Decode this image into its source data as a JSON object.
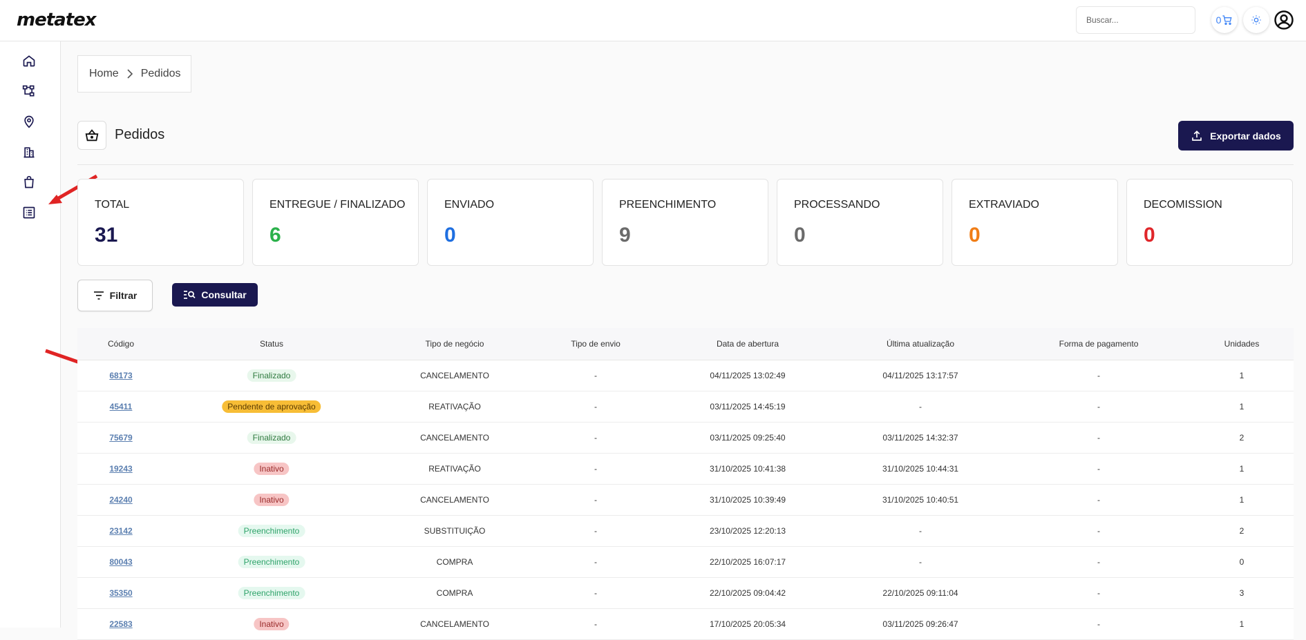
{
  "app": {
    "logo": "metatex"
  },
  "header": {
    "search_placeholder": "Buscar...",
    "cart_count": "0",
    "icons": [
      "cart-icon",
      "sun-icon",
      "user-circle-icon"
    ]
  },
  "sidebar": {
    "icons": [
      "home-icon",
      "hierarchy-icon",
      "location-pin-icon",
      "buildings-icon",
      "shopping-bag-icon",
      "list-icon"
    ]
  },
  "breadcrumb": {
    "home": "Home",
    "current": "Pedidos"
  },
  "page": {
    "title": "Pedidos",
    "export_label": "Exportar dados"
  },
  "stats": [
    {
      "label": "TOTAL",
      "value": "31",
      "color": "#1a1850"
    },
    {
      "label": "ENTREGUE / FINALIZADO",
      "value": "6",
      "color": "#2bb14b"
    },
    {
      "label": "ENVIADO",
      "value": "0",
      "color": "#1f6fe0"
    },
    {
      "label": "PREENCHIMENTO",
      "value": "9",
      "color": "#6b6b6b"
    },
    {
      "label": "PROCESSANDO",
      "value": "0",
      "color": "#6b6b6b"
    },
    {
      "label": "EXTRAVIADO",
      "value": "0",
      "color": "#f07d16"
    },
    {
      "label": "DECOMISSION",
      "value": "0",
      "color": "#e0262a"
    }
  ],
  "actions": {
    "filter_label": "Filtrar",
    "consult_label": "Consultar"
  },
  "table": {
    "columns": [
      "Código",
      "Status",
      "Tipo de negócio",
      "Tipo de envio",
      "Data de abertura",
      "Última atualização",
      "Forma de pagamento",
      "Unidades"
    ],
    "rows": [
      {
        "code": "68173",
        "status": "Finalizado",
        "status_type": "final",
        "business": "CANCELAMENTO",
        "shipping": "-",
        "opened": "04/11/2025 13:02:49",
        "updated": "04/11/2025 13:17:57",
        "payment": "-",
        "units": "1"
      },
      {
        "code": "45411",
        "status": "Pendente de aprovação",
        "status_type": "pend",
        "business": "REATIVAÇÃO",
        "shipping": "-",
        "opened": "03/11/2025 14:45:19",
        "updated": "-",
        "payment": "-",
        "units": "1"
      },
      {
        "code": "75679",
        "status": "Finalizado",
        "status_type": "final",
        "business": "CANCELAMENTO",
        "shipping": "-",
        "opened": "03/11/2025 09:25:40",
        "updated": "03/11/2025 14:32:37",
        "payment": "-",
        "units": "2"
      },
      {
        "code": "19243",
        "status": "Inativo",
        "status_type": "inat",
        "business": "REATIVAÇÃO",
        "shipping": "-",
        "opened": "31/10/2025 10:41:38",
        "updated": "31/10/2025 10:44:31",
        "payment": "-",
        "units": "1"
      },
      {
        "code": "24240",
        "status": "Inativo",
        "status_type": "inat",
        "business": "CANCELAMENTO",
        "shipping": "-",
        "opened": "31/10/2025 10:39:49",
        "updated": "31/10/2025 10:40:51",
        "payment": "-",
        "units": "1"
      },
      {
        "code": "23142",
        "status": "Preenchimento",
        "status_type": "pree",
        "business": "SUBSTITUIÇÃO",
        "shipping": "-",
        "opened": "23/10/2025 12:20:13",
        "updated": "-",
        "payment": "-",
        "units": "2"
      },
      {
        "code": "80043",
        "status": "Preenchimento",
        "status_type": "pree",
        "business": "COMPRA",
        "shipping": "-",
        "opened": "22/10/2025 16:07:17",
        "updated": "-",
        "payment": "-",
        "units": "0"
      },
      {
        "code": "35350",
        "status": "Preenchimento",
        "status_type": "pree",
        "business": "COMPRA",
        "shipping": "-",
        "opened": "22/10/2025 09:04:42",
        "updated": "22/10/2025 09:11:04",
        "payment": "-",
        "units": "3"
      },
      {
        "code": "22583",
        "status": "Inativo",
        "status_type": "inat",
        "business": "CANCELAMENTO",
        "shipping": "-",
        "opened": "17/10/2025 20:05:34",
        "updated": "03/11/2025 09:26:47",
        "payment": "-",
        "units": "1"
      }
    ]
  }
}
